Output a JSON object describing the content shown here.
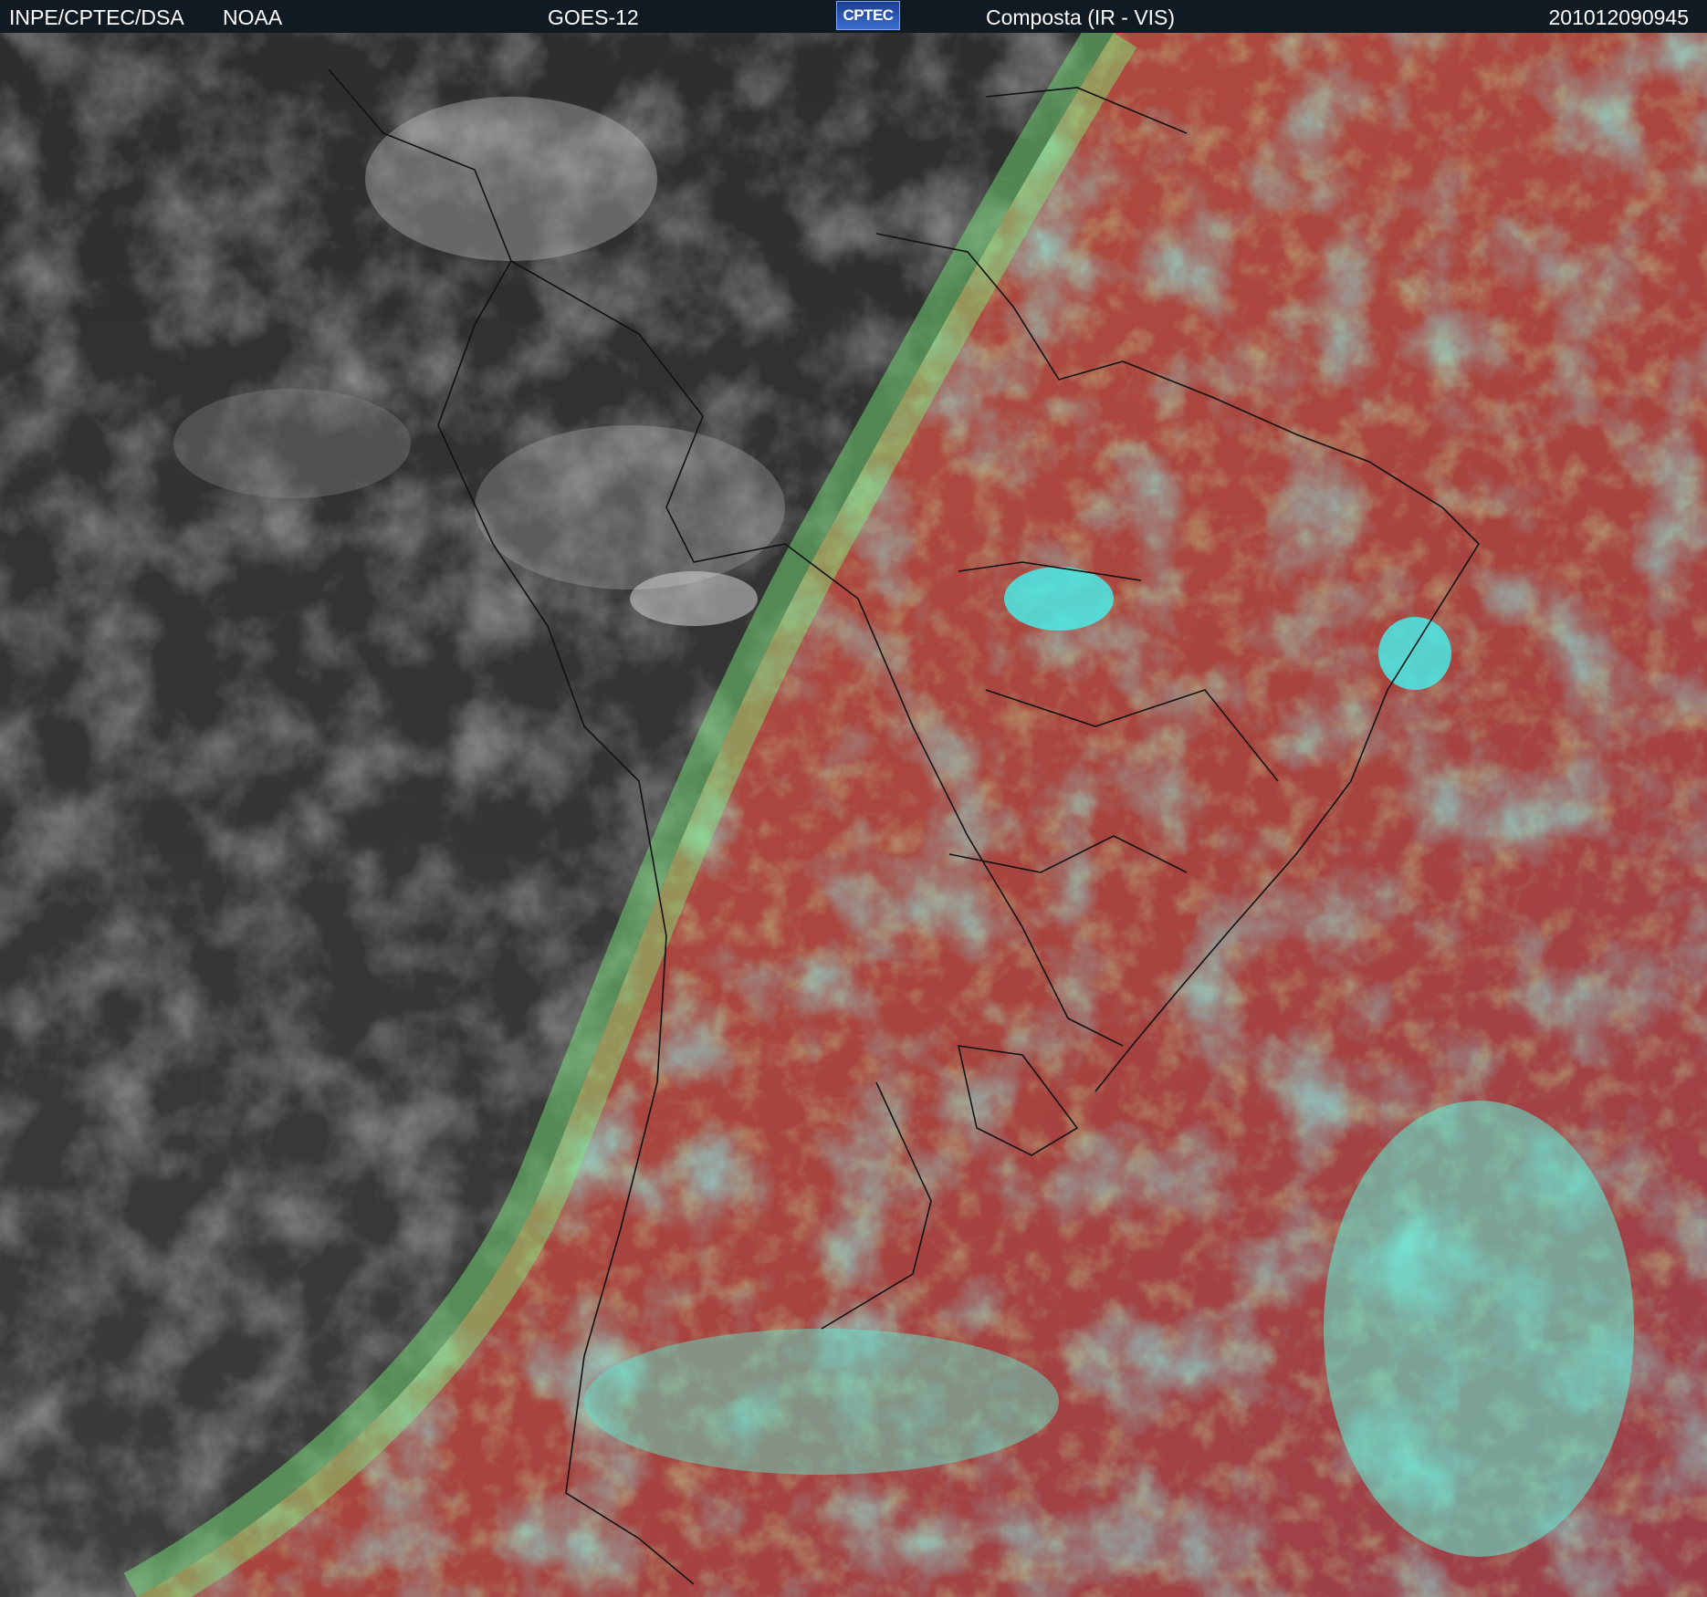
{
  "header": {
    "source": "INPE/CPTEC/DSA",
    "agency": "NOAA",
    "satellite": "GOES-12",
    "logo_text": "CPTEC",
    "product": "Composta (IR - VIS)",
    "timestamp": "201012090945"
  },
  "icons": {
    "logo": "cptec-logo-icon"
  },
  "colors": {
    "header_bg": "#101a22",
    "night_side": "#3a3a3a",
    "day_side_clear": "#b04a3c",
    "day_side_cloud": "#38f0e4",
    "terminator_band": "#7cf07c",
    "boundaries": "#111111"
  }
}
